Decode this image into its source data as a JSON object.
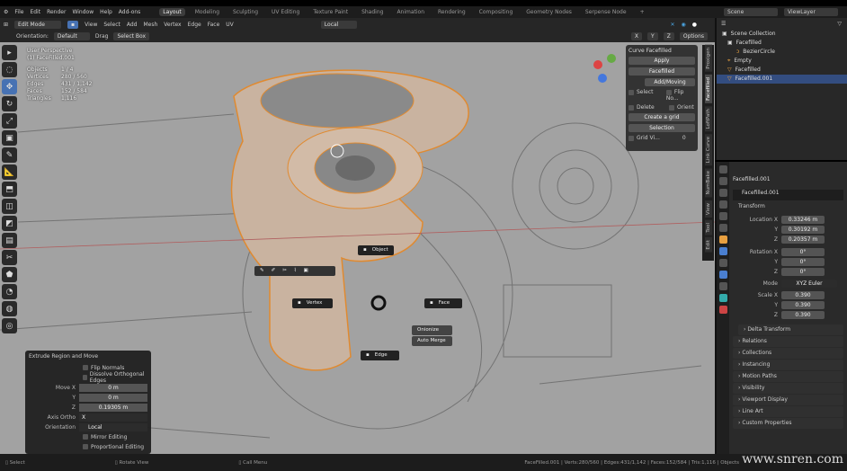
{
  "menu": [
    "File",
    "Edit",
    "Render",
    "Window",
    "Help",
    "Add-ons"
  ],
  "workspaces": [
    "Layout",
    "Modeling",
    "Sculpting",
    "UV Editing",
    "Texture Paint",
    "Shading",
    "Animation",
    "Rendering",
    "Compositing",
    "Geometry Nodes",
    "Serpense Node",
    "+"
  ],
  "scene": "Scene",
  "view_layer": "ViewLayer",
  "header": {
    "mode": "Edit Mode",
    "menus": [
      "View",
      "Select",
      "Add",
      "Mesh",
      "Vertex",
      "Edge",
      "Face",
      "UV"
    ],
    "orientation_transform": "Local",
    "orientation_label": "Orientation:",
    "orientation": "Default",
    "drag_label": "Drag",
    "drag": "Select Box",
    "axes": [
      "X",
      "Y",
      "Z"
    ],
    "options": "Options"
  },
  "stats": {
    "view": "User Perspective",
    "object": "(1) FaceFilled.001",
    "rows": [
      [
        "Objects",
        "1 / 4"
      ],
      [
        "Vertices",
        "280 / 560"
      ],
      [
        "Edges",
        "431 / 1,142"
      ],
      [
        "Faces",
        "152 / 584"
      ],
      [
        "Triangles",
        "1,116"
      ]
    ]
  },
  "npanel": {
    "title": "Curve Facefilled",
    "apply": "Apply",
    "facefilled": "Facefilled",
    "add_moving": "Add/Moving",
    "select": "Select",
    "flip": "Flip No...",
    "delete": "Delete",
    "orient": "Orient",
    "create_grid": "Create a grid",
    "selection": "Selection",
    "grid_v": "Grid Vi...",
    "grid_val": "0"
  },
  "vtabs": [
    "Proxigen",
    "Facefilled",
    "LoftPath",
    "Link Curve",
    "NumBake",
    "View",
    "Tool",
    "Edit"
  ],
  "pie": {
    "object": "Object",
    "vertex": "Vertex",
    "face": "Face",
    "edge": "Edge",
    "onion": "Onionize",
    "automerge": "Auto Merge"
  },
  "outliner": {
    "root": "Scene Collection",
    "items": [
      "Facefilled",
      "BezierCircle",
      "Empty",
      "Facefilled",
      "Facefilled.001"
    ]
  },
  "properties": {
    "object": "Facefilled.001",
    "data": "Facefilled.001",
    "transform": "Transform",
    "loc": [
      "0.33246 m",
      "0.30192 m",
      "0.20357 m"
    ],
    "rot": [
      "0°",
      "0°",
      "0°"
    ],
    "mode_label": "Mode",
    "mode": "XYZ Euler",
    "scale": [
      "0.390",
      "0.390",
      "0.390"
    ],
    "labels": {
      "lx": "Location X",
      "rx": "Rotation X",
      "sx": "Scale X",
      "y": "Y",
      "z": "Z"
    },
    "sections": [
      "Delta Transform",
      "Relations",
      "Collections",
      "Instancing",
      "Motion Paths",
      "Visibility",
      "Viewport Display",
      "Line Art",
      "Custom Properties"
    ]
  },
  "operator": {
    "title": "Extrude Region and Move",
    "flip": "Flip Normals",
    "dissolve": "Dissolve Orthogonal Edges",
    "move_label": "Move X",
    "move": [
      "0 m",
      "0 m",
      "0.19305 m"
    ],
    "axis_label": "Axis Ortho",
    "axis": "X",
    "orient_label": "Orientation",
    "orient": "Local",
    "mirror": "Mirror Editing",
    "prop": "Proportional Editing"
  },
  "status": {
    "select": "Select",
    "rotate": "Rotate View",
    "menu": "Call Menu",
    "info": "FaceFilled.001 | Verts:280/560 | Edges:431/1,142 | Faces:152/584 | Tris:1,116 | Objects"
  },
  "watermark": "www.snren.com"
}
